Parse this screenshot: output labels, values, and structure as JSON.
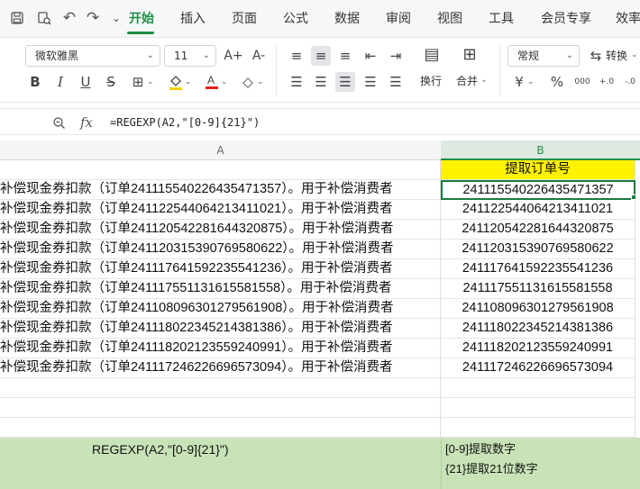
{
  "quick_access": {
    "icons": [
      "save-icon",
      "print-preview-icon",
      "undo-icon",
      "redo-icon",
      "dropdown-icon"
    ]
  },
  "tabs": [
    {
      "label": "开始",
      "active": true
    },
    {
      "label": "插入"
    },
    {
      "label": "页面"
    },
    {
      "label": "公式"
    },
    {
      "label": "数据"
    },
    {
      "label": "审阅"
    },
    {
      "label": "视图"
    },
    {
      "label": "工具"
    },
    {
      "label": "会员专享"
    },
    {
      "label": "效率"
    }
  ],
  "ribbon": {
    "font_name": "微软雅黑",
    "font_size": "11",
    "number_format": "常规",
    "convert_label": "转换",
    "wrap_label": "换行",
    "merge_label": "合并",
    "grow_font": "A+",
    "shrink_font": "A-",
    "bold": "B",
    "italic": "I",
    "underline": "U",
    "strike": "S",
    "currency": "¥",
    "percent": "%",
    "thousands": "000",
    "inc_decimal": "+.0",
    "dec_decimal": "-.0"
  },
  "formula_bar": {
    "formula": "=REGEXP(A2,\"[0-9]{21}\")"
  },
  "columns": [
    {
      "label": "A"
    },
    {
      "label": "B",
      "selected": true
    }
  ],
  "sheet": {
    "header_b": "提取订单号",
    "rows": [
      {
        "a": "补偿现金券扣款（订单241115540226435471357）。用于补偿消费者",
        "b": "241115540226435471357"
      },
      {
        "a": "补偿现金券扣款（订单241122544064213411021）。用于补偿消费者",
        "b": "241122544064213411021"
      },
      {
        "a": "补偿现金券扣款（订单241120542281644320875）。用于补偿消费者",
        "b": "241120542281644320875"
      },
      {
        "a": "补偿现金券扣款（订单241120315390769580622）。用于补偿消费者",
        "b": "241120315390769580622"
      },
      {
        "a": "补偿现金券扣款（订单241117641592235541236）。用于补偿消费者",
        "b": "241117641592235541236"
      },
      {
        "a": "补偿现金券扣款（订单241117551131615581558）。用于补偿消费者",
        "b": "241117551131615581558"
      },
      {
        "a": "补偿现金券扣款（订单241108096301279561908）。用于补偿消费者",
        "b": "241108096301279561908"
      },
      {
        "a": "补偿现金券扣款（订单241118022345214381386）。用于补偿消费者",
        "b": "241118022345214381386"
      },
      {
        "a": "补偿现金券扣款（订单241118202123559240991）。用于补偿消费者",
        "b": "241118202123559240991"
      },
      {
        "a": "补偿现金券扣款（订单241117246226696573094）。用于补偿消费者",
        "b": "241117246226696573094"
      }
    ]
  },
  "explanation": {
    "formula": "REGEXP(A2,\"[0-9]{21}\")",
    "note1": "[0-9]提取数字",
    "note2": "{21}提取21位数字"
  },
  "colors": {
    "accent": "#1f8e45",
    "header_fill": "#fff200",
    "band_fill": "#c9e3b8"
  }
}
